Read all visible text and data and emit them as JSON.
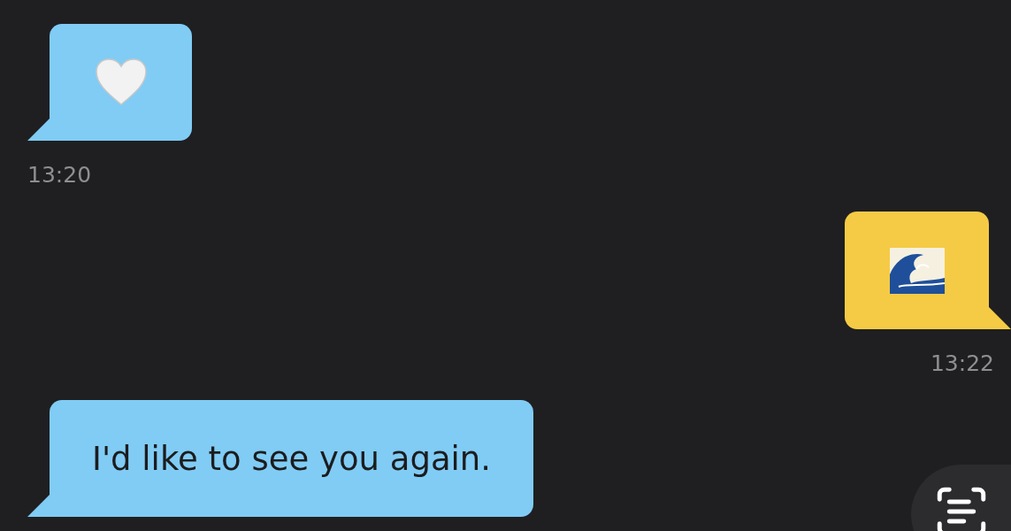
{
  "messages": [
    {
      "own": false,
      "kind": "heart",
      "time": "13:20"
    },
    {
      "own": true,
      "kind": "wave",
      "time": "13:22"
    },
    {
      "own": false,
      "kind": "text",
      "text": "I'd like to see you again."
    }
  ]
}
